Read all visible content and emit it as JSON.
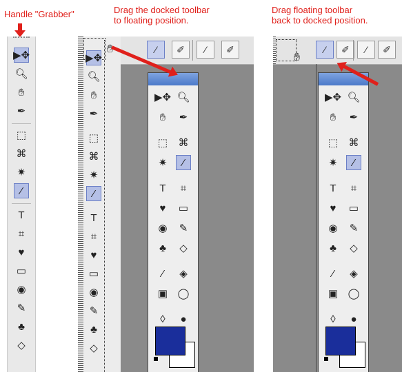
{
  "annotations": {
    "handle_grabber": "Handle \"Grabber\"",
    "drag_to_floating": "Drag the docked toolbar\nto floating position.",
    "drag_back": "Drag floating toolbar\nback to docked position."
  },
  "colors": {
    "annotation": "#e0201b",
    "foreground_swatch": "#1a2e9b",
    "background_swatch": "#ffffff",
    "selection": "#b5c0e6",
    "title_bar": "#4b79c9",
    "workspace": "#8a8a8a"
  },
  "toolbox_docked_tools": [
    {
      "icon": "move-tool-icon",
      "glyph": "▶✥",
      "selected": true
    },
    {
      "icon": "zoom-tool-icon",
      "glyph": "🔍︎",
      "selected": false
    },
    {
      "icon": "hand-tool-icon",
      "glyph": "✋︎",
      "selected": false
    },
    {
      "icon": "eyedropper-tool-icon",
      "glyph": "✒",
      "selected": false
    },
    {
      "icon": "marquee-tool-icon",
      "glyph": "⬚",
      "selected": false
    },
    {
      "icon": "lasso-tool-icon",
      "glyph": "⌘",
      "selected": false
    },
    {
      "icon": "magic-wand-tool-icon",
      "glyph": "✷",
      "selected": false
    },
    {
      "icon": "brush-tool-icon",
      "glyph": "⁄",
      "selected": true
    },
    {
      "icon": "type-tool-icon",
      "glyph": "T",
      "selected": false
    },
    {
      "icon": "crop-tool-icon",
      "glyph": "⌗",
      "selected": false
    },
    {
      "icon": "shape-tool-icon",
      "glyph": "♥",
      "selected": false
    },
    {
      "icon": "screen-mode-icon",
      "glyph": "▭",
      "selected": false
    },
    {
      "icon": "red-eye-tool-icon",
      "glyph": "◉",
      "selected": false
    },
    {
      "icon": "healing-tool-icon",
      "glyph": "✎",
      "selected": false
    },
    {
      "icon": "stamp-tool-icon",
      "glyph": "♣",
      "selected": false
    },
    {
      "icon": "eraser-tool-icon",
      "glyph": "◇",
      "selected": false
    }
  ],
  "toolbox_float_tools": [
    {
      "icon": "move-tool-icon",
      "glyph": "▶✥",
      "selected": false
    },
    {
      "icon": "zoom-tool-icon",
      "glyph": "🔍︎",
      "selected": false
    },
    {
      "icon": "hand-tool-icon",
      "glyph": "✋︎",
      "selected": false
    },
    {
      "icon": "eyedropper-tool-icon",
      "glyph": "✒",
      "selected": false
    },
    {
      "icon": "marquee-tool-icon",
      "glyph": "⬚",
      "selected": false
    },
    {
      "icon": "lasso-tool-icon",
      "glyph": "⌘",
      "selected": false
    },
    {
      "icon": "magic-wand-tool-icon",
      "glyph": "✷",
      "selected": false
    },
    {
      "icon": "brush-tool-icon",
      "glyph": "⁄",
      "selected": true
    },
    {
      "icon": "type-tool-icon",
      "glyph": "T",
      "selected": false
    },
    {
      "icon": "crop-tool-icon",
      "glyph": "⌗",
      "selected": false
    },
    {
      "icon": "shape-tool-icon",
      "glyph": "♥",
      "selected": false
    },
    {
      "icon": "screen-mode-icon",
      "glyph": "▭",
      "selected": false
    },
    {
      "icon": "red-eye-tool-icon",
      "glyph": "◉",
      "selected": false
    },
    {
      "icon": "healing-tool-icon",
      "glyph": "✎",
      "selected": false
    },
    {
      "icon": "stamp-tool-icon",
      "glyph": "♣",
      "selected": false
    },
    {
      "icon": "eraser-tool-icon",
      "glyph": "◇",
      "selected": false
    },
    {
      "icon": "smudge-tool-icon",
      "glyph": "⁄",
      "selected": false
    },
    {
      "icon": "paint-bucket-tool-icon",
      "glyph": "◈",
      "selected": false
    },
    {
      "icon": "gradient-tool-icon",
      "glyph": "▣",
      "selected": false
    },
    {
      "icon": "speech-bubble-tool-icon",
      "glyph": "◯",
      "selected": false
    },
    {
      "icon": "blur-tool-icon",
      "glyph": "◊",
      "selected": false
    },
    {
      "icon": "sponge-tool-icon",
      "glyph": "●",
      "selected": false
    }
  ],
  "option_bar_tools": [
    {
      "icon": "pencil-option-icon",
      "glyph": "⁄"
    },
    {
      "icon": "brush-option-icon",
      "glyph": "✐"
    },
    {
      "icon": "pencil-alt-option-icon",
      "glyph": "⁄"
    },
    {
      "icon": "brush-plus-option-icon",
      "glyph": "✐"
    }
  ]
}
